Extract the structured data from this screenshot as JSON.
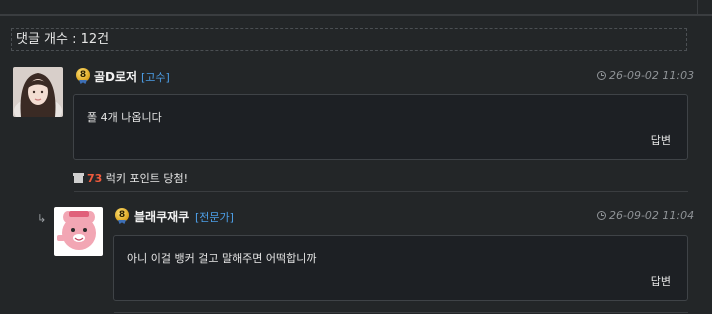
{
  "header": {
    "comment_count": "댓글 개수 : 12건"
  },
  "comments": [
    {
      "level": "8",
      "nickname": "골D로저",
      "rank": "[고수]",
      "timestamp": "26-09-02 11:03",
      "body": "폴 4개 나옵니다",
      "reply_label": "답변",
      "lucky": {
        "points": "73",
        "text": " 럭키 포인트 당첨!"
      }
    },
    {
      "level": "8",
      "nickname": "블래쿠재쿠",
      "rank": "[전문가]",
      "timestamp": "26-09-02 11:04",
      "body": "아니 이걸 뱅커 걸고 말해주면 어떡합니까",
      "reply_label": "답변"
    }
  ],
  "icons": {
    "timestamp": "clock-icon",
    "lucky": "gift-icon",
    "reply_indent": "reply-arrow-icon",
    "level": "level-badge-icon"
  },
  "colors": {
    "rank": "#4d9fe8",
    "lucky_points": "#ef5a3c",
    "background": "#232628"
  }
}
